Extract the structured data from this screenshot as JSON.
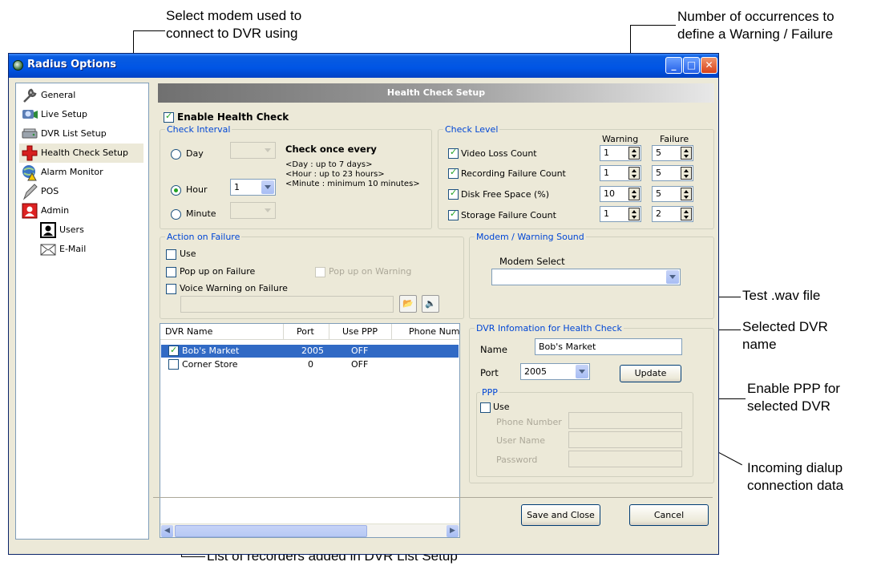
{
  "callouts": {
    "modem": [
      "Select modem used to",
      "connect to DVR using"
    ],
    "occurrences": [
      "Number of occurrences to",
      "define a Warning / Failure"
    ],
    "test_wav": "Test .wav file",
    "selected_dvr": [
      "Selected DVR",
      "name"
    ],
    "enable_ppp": [
      "Enable PPP for",
      "selected DVR"
    ],
    "dialup": [
      "Incoming dialup",
      "connection data"
    ],
    "recorders": "List of recorders added in DVR List Setup"
  },
  "window": {
    "title": "Radius Options",
    "buttons": {
      "minimize": "_",
      "maximize": "□",
      "close": "✕"
    }
  },
  "tree": {
    "items": [
      "General",
      "Live Setup",
      "DVR List Setup",
      "Health Check Setup",
      "Alarm Monitor",
      "POS",
      "Admin"
    ],
    "sub_items": [
      "Users",
      "E-Mail"
    ],
    "selected": "Health Check Setup"
  },
  "banner": "Health Check Setup",
  "enable_health_check": {
    "label": "Enable Health Check",
    "checked": true
  },
  "check_interval": {
    "legend": "Check Interval",
    "options": [
      "Day",
      "Hour",
      "Minute"
    ],
    "selected": "Hour",
    "hour_value": "1",
    "heading": "Check once every",
    "notes": [
      "<Day : up to 7 days>",
      "<Hour : up to 23 hours>",
      "<Minute : minimum 10 minutes>"
    ]
  },
  "check_level": {
    "legend": "Check Level",
    "warning_header": "Warning",
    "failure_header": "Failure",
    "rows": [
      {
        "label": "Video Loss Count",
        "warning": "1",
        "failure": "5"
      },
      {
        "label": "Recording Failure Count",
        "warning": "1",
        "failure": "5"
      },
      {
        "label": "Disk Free Space (%)",
        "warning": "10",
        "failure": "5"
      },
      {
        "label": "Storage Failure Count",
        "warning": "1",
        "failure": "2"
      }
    ]
  },
  "action_on_failure": {
    "legend": "Action on Failure",
    "use": "Use",
    "popup_failure": "Pop up on Failure",
    "popup_warning": "Pop up on Warning",
    "voice_warning": "Voice Warning on Failure",
    "browse_icon": "folder-open-icon",
    "test_icon": "speaker-icon"
  },
  "modem": {
    "legend": "Modem / Warning Sound",
    "select_label": "Modem Select",
    "value": ""
  },
  "dvr_list": {
    "columns": [
      "DVR Name",
      "Port",
      "Use PPP",
      "Phone Num"
    ],
    "rows": [
      {
        "name": "Bob's Market",
        "port": "2005",
        "ppp": "OFF",
        "checked": true,
        "selected": true
      },
      {
        "name": "Corner Store",
        "port": "0",
        "ppp": "OFF",
        "checked": false,
        "selected": false
      }
    ]
  },
  "dvr_info": {
    "legend": "DVR Infomation for Health Check",
    "name_label": "Name",
    "name_value": "Bob's Market",
    "port_label": "Port",
    "port_value": "2005",
    "update": "Update",
    "ppp": {
      "legend": "PPP",
      "use": "Use",
      "phone": "Phone Number",
      "user": "User Name",
      "password": "Password"
    }
  },
  "footer": {
    "save": "Save and Close",
    "cancel": "Cancel"
  }
}
